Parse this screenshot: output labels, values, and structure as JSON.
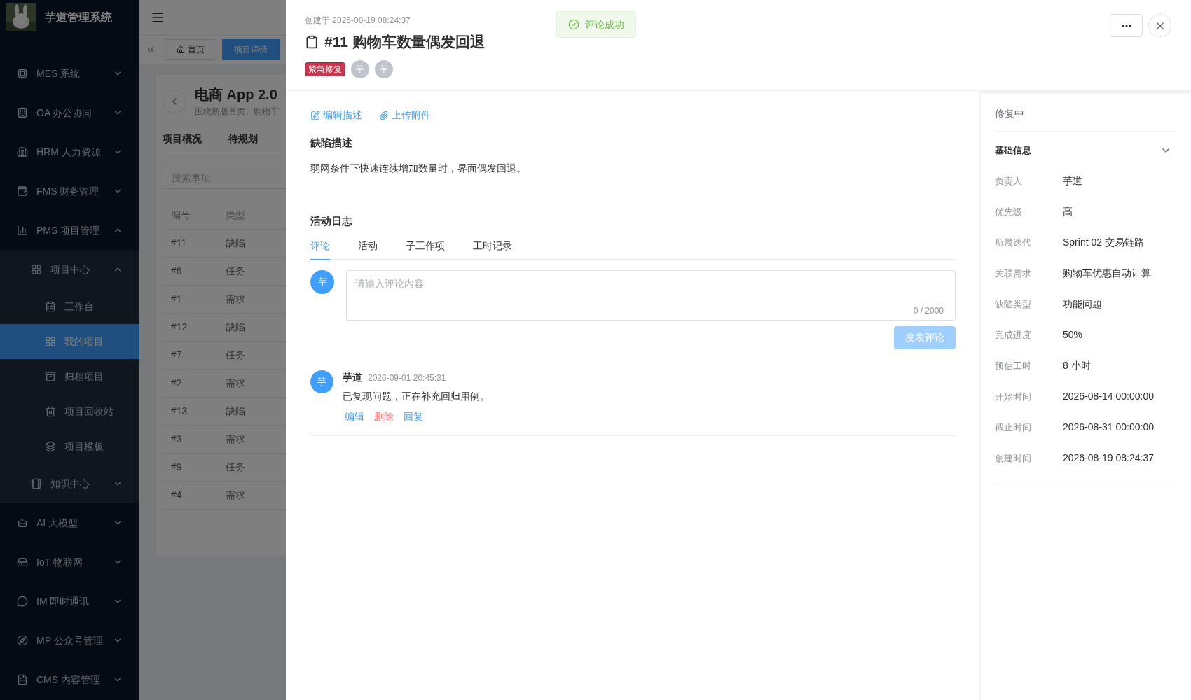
{
  "sidebar": {
    "brand": "芋道管理系统",
    "items": [
      {
        "label": "MES 系统",
        "expanded": false
      },
      {
        "label": "OA 办公协同",
        "expanded": false
      },
      {
        "label": "HRM 人力资源",
        "expanded": false
      },
      {
        "label": "FMS 财务管理",
        "expanded": false
      },
      {
        "label": "PMS 项目管理",
        "expanded": true,
        "children": [
          {
            "label": "项目中心",
            "expanded": true,
            "children": [
              {
                "label": "工作台",
                "selected": false
              },
              {
                "label": "我的项目",
                "selected": true
              },
              {
                "label": "归档项目",
                "selected": false
              },
              {
                "label": "项目回收站",
                "selected": false
              },
              {
                "label": "项目模板",
                "selected": false
              }
            ]
          },
          {
            "label": "知识中心",
            "expanded": false
          }
        ]
      },
      {
        "label": "AI 大模型",
        "expanded": false
      },
      {
        "label": "IoT 物联网",
        "expanded": false
      },
      {
        "label": "IM 即时通讯",
        "expanded": false
      },
      {
        "label": "MP 公众号管理",
        "expanded": false
      },
      {
        "label": "CMS 内容管理",
        "expanded": false
      }
    ]
  },
  "page_tabs": [
    {
      "label": "首页",
      "selected": false
    },
    {
      "label": "项目详情",
      "selected": true
    }
  ],
  "project": {
    "title": "电商 App 2.0",
    "subtitle": "围绕新版首页、购物车",
    "tabs": [
      "项目概况",
      "待规划"
    ],
    "search": {
      "placeholder": "搜索事项"
    },
    "table": {
      "columns": [
        "编号",
        "类型"
      ],
      "rows": [
        [
          "#11",
          "缺陷"
        ],
        [
          "#6",
          "任务"
        ],
        [
          "#1",
          "需求"
        ],
        [
          "#12",
          "缺陷"
        ],
        [
          "#7",
          "任务"
        ],
        [
          "#2",
          "需求"
        ],
        [
          "#13",
          "缺陷"
        ],
        [
          "#3",
          "需求"
        ],
        [
          "#9",
          "任务"
        ],
        [
          "#4",
          "需求"
        ]
      ]
    }
  },
  "drawer": {
    "created": "创建于 2026-08-19 08:24:37",
    "title": "#11 购物车数量偶发回退",
    "tag": "紧急修复",
    "avatars": [
      "芋",
      "芋"
    ],
    "toast": "评论成功",
    "actions": [
      "编辑描述",
      "上传附件"
    ],
    "description_heading": "缺陷描述",
    "description": "弱网条件下快速连续增加数量时，界面偶发回退。",
    "activity_heading": "活动日志",
    "tabs": [
      {
        "label": "评论",
        "selected": true
      },
      {
        "label": "活动",
        "selected": false
      },
      {
        "label": "子工作项",
        "selected": false
      },
      {
        "label": "工时记录",
        "selected": false
      }
    ],
    "comment_avatar": "芋",
    "comment_input": {
      "placeholder": "请输入评论内容",
      "counter": "0 / 2000"
    },
    "submit": {
      "label": "发表评论",
      "disabled": true
    },
    "comments": [
      {
        "avatar": "芋",
        "author": "芋道",
        "time": "2026-09-01 20:45:31",
        "text": "已复现问题，正在补充回归用例。",
        "actions": [
          {
            "label": "编辑",
            "kind": "link"
          },
          {
            "label": "删除",
            "kind": "danger"
          },
          {
            "label": "回复",
            "kind": "link"
          }
        ]
      }
    ]
  },
  "details": {
    "status": "修复中",
    "section": {
      "title": "基础信息",
      "expanded": true
    },
    "fields": [
      {
        "label": "负责人",
        "value": "芋道"
      },
      {
        "label": "优先级",
        "value": "高"
      },
      {
        "label": "所属迭代",
        "value": "Sprint 02 交易链路"
      },
      {
        "label": "关联需求",
        "value": "购物车优惠自动计算"
      },
      {
        "label": "缺陷类型",
        "value": "功能问题"
      },
      {
        "label": "完成进度",
        "value": "50%"
      },
      {
        "label": "预估工时",
        "value": "8 小时"
      },
      {
        "label": "开始时间",
        "value": "2026-08-14 00:00:00"
      },
      {
        "label": "截止时间",
        "value": "2026-08-31 00:00:00"
      },
      {
        "label": "创建时间",
        "value": "2026-08-19 08:24:37"
      }
    ]
  }
}
